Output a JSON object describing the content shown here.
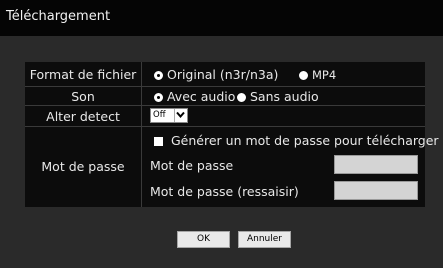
{
  "window": {
    "title": "Téléchargement"
  },
  "form": {
    "file_format": {
      "label": "Format de fichier",
      "options": [
        "Original (n3r/n3a)",
        "MP4"
      ],
      "selected": "Original (n3r/n3a)"
    },
    "sound": {
      "label": "Son",
      "options": [
        "Avec audio",
        "Sans audio"
      ],
      "selected": "Avec audio"
    },
    "alter_detect": {
      "label": "Alter detect",
      "value": "Off"
    },
    "password": {
      "label": "Mot de passe",
      "generate_checkbox_label": "Générer un mot de passe pour télécharger",
      "generate_checked": false,
      "field_label": "Mot de passe",
      "field_value": "",
      "confirm_label": "Mot de passe (ressaisir)",
      "confirm_value": ""
    }
  },
  "buttons": {
    "ok": "OK",
    "cancel": "Annuler"
  }
}
